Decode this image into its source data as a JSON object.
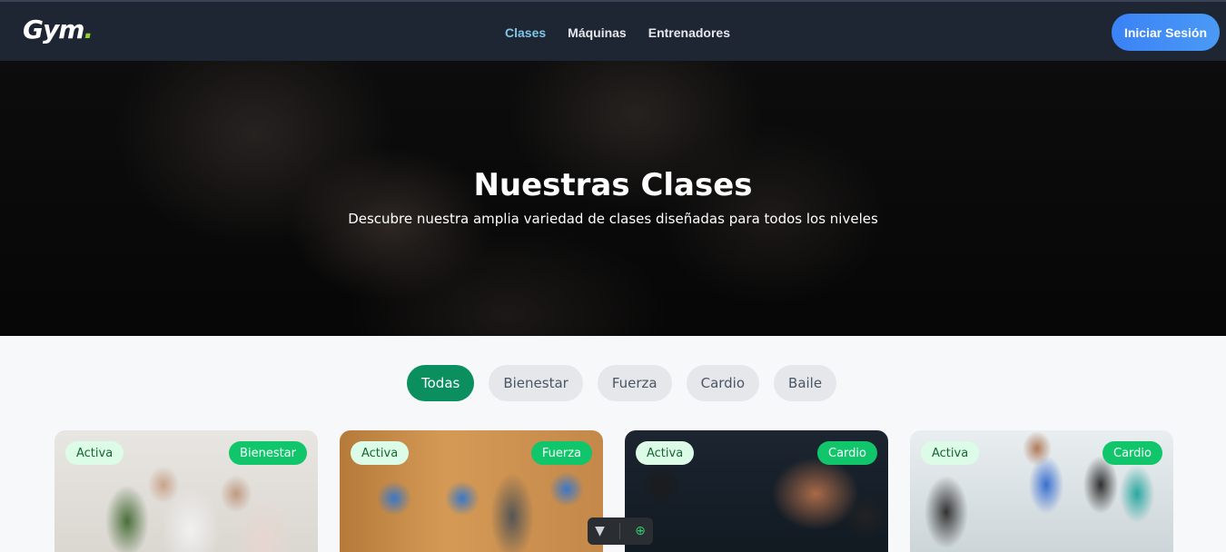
{
  "brand": {
    "name": "Gym",
    "dot": ".",
    "accent_color": "#8fd12e"
  },
  "nav": {
    "links": [
      {
        "label": "Clases",
        "active": true
      },
      {
        "label": "Máquinas",
        "active": false
      },
      {
        "label": "Entrenadores",
        "active": false
      }
    ],
    "login_label": "Iniciar Sesión"
  },
  "hero": {
    "title": "Nuestras Clases",
    "subtitle": "Descubre nuestra amplia variedad de clases diseñadas para todos los niveles"
  },
  "filters": {
    "options": [
      "Todas",
      "Bienestar",
      "Fuerza",
      "Cardio",
      "Baile"
    ],
    "selected": "Todas"
  },
  "cards": [
    {
      "status": "Activa",
      "category": "Bienestar"
    },
    {
      "status": "Activa",
      "category": "Fuerza"
    },
    {
      "status": "Activa",
      "category": "Cardio"
    },
    {
      "status": "Activa",
      "category": "Cardio"
    }
  ],
  "toolbar": {
    "left_icon": "chevron-down-icon",
    "right_icon": "crosshair-icon"
  },
  "colors": {
    "primary_green": "#0b8f5e",
    "badge_green": "#10c56a",
    "nav_bg": "#1e2533",
    "login_blue": "#3b82f6"
  }
}
